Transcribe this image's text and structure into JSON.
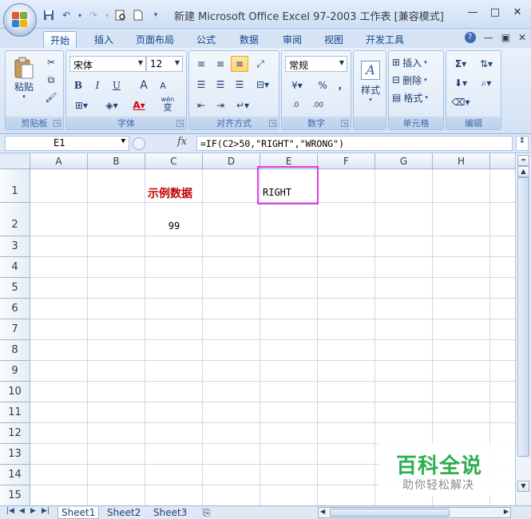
{
  "window": {
    "title": "新建 Microsoft Office Excel 97-2003 工作表 [兼容模式] ...",
    "controls": [
      "—",
      "□",
      "✕"
    ]
  },
  "tabs": [
    "开始",
    "插入",
    "页面布局",
    "公式",
    "数据",
    "审阅",
    "视图",
    "开发工具"
  ],
  "active_tab": "开始",
  "ribbon": {
    "clipboard": {
      "label": "剪贴板",
      "paste": "粘贴"
    },
    "font": {
      "label": "字体",
      "name": "宋体",
      "size": "12",
      "bold": "B",
      "italic": "I",
      "underline": "U",
      "grow": "A",
      "shrink": "A",
      "phonetic": "wén",
      "phonetic_char": "变"
    },
    "alignment": {
      "label": "对齐方式"
    },
    "number": {
      "label": "数字",
      "format": "常规",
      "percent": "%",
      "comma": ",",
      "inc_decimal": ".0",
      "dec_decimal": ".00"
    },
    "styles": {
      "label": "样式",
      "button": "样式"
    },
    "cells": {
      "label": "单元格",
      "insert": "插入",
      "delete": "删除",
      "format": "格式"
    },
    "editing": {
      "label": "编辑"
    }
  },
  "formula_bar": {
    "name_box": "E1",
    "fx": "fx",
    "formula": "=IF(C2>50,\"RIGHT\",\"WRONG\")"
  },
  "grid": {
    "columns": [
      "A",
      "B",
      "C",
      "D",
      "E",
      "F",
      "G",
      "H"
    ],
    "rows": [
      "1",
      "2",
      "3",
      "4",
      "5",
      "6",
      "7",
      "8",
      "9",
      "10",
      "11",
      "12",
      "13",
      "14",
      "15"
    ],
    "cells": {
      "C1": "示例数据",
      "C2": "99",
      "E1": "RIGHT"
    },
    "selected_cell": "E1",
    "accent_color": "#e23ce0",
    "header_text_color": "#c00000"
  },
  "sheets": [
    "Sheet1",
    "Sheet2",
    "Sheet3"
  ],
  "active_sheet": "Sheet1",
  "watermark": {
    "main": "百科全说",
    "sub": "助你轻松解决"
  }
}
